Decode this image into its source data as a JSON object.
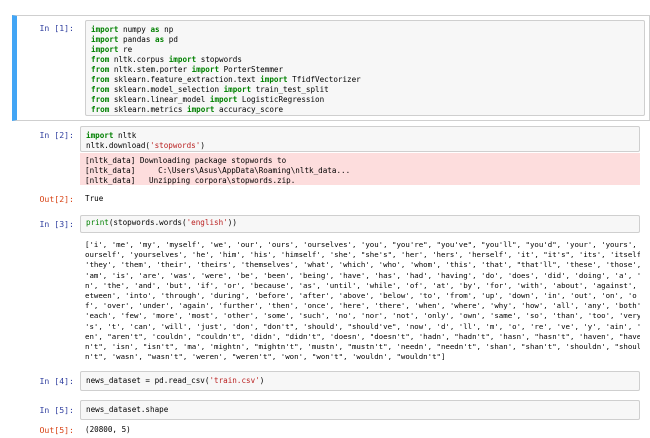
{
  "cells": [
    {
      "prompt": "In [1]:",
      "code": [
        [
          [
            "import",
            "kw"
          ],
          [
            " numpy ",
            ""
          ],
          [
            "as",
            "kw"
          ],
          [
            " np",
            ""
          ]
        ],
        [
          [
            "import",
            "kw"
          ],
          [
            " pandas ",
            ""
          ],
          [
            "as",
            "kw"
          ],
          [
            " pd",
            ""
          ]
        ],
        [
          [
            "import",
            "kw"
          ],
          [
            " re",
            ""
          ]
        ],
        [
          [
            "from",
            "kw"
          ],
          [
            " nltk.corpus ",
            ""
          ],
          [
            "import",
            "kw"
          ],
          [
            " stopwords",
            ""
          ]
        ],
        [
          [
            "from",
            "kw"
          ],
          [
            " nltk.stem.porter ",
            ""
          ],
          [
            "import",
            "kw"
          ],
          [
            " PorterStemmer",
            ""
          ]
        ],
        [
          [
            "from",
            "kw"
          ],
          [
            " sklearn.feature_extraction.text ",
            ""
          ],
          [
            "import",
            "kw"
          ],
          [
            " TfidfVectorizer",
            ""
          ]
        ],
        [
          [
            "from",
            "kw"
          ],
          [
            " sklearn.model_selection ",
            ""
          ],
          [
            "import",
            "kw"
          ],
          [
            " train_test_split",
            ""
          ]
        ],
        [
          [
            "from",
            "kw"
          ],
          [
            " sklearn.linear_model ",
            ""
          ],
          [
            "import",
            "kw"
          ],
          [
            " LogisticRegression",
            ""
          ]
        ],
        [
          [
            "from",
            "kw"
          ],
          [
            " sklearn.metrics ",
            ""
          ],
          [
            "import",
            "kw"
          ],
          [
            " accuracy_score",
            ""
          ]
        ]
      ]
    },
    {
      "prompt": "In [2]:",
      "code": [
        [
          [
            "import",
            "kw"
          ],
          [
            " nltk",
            ""
          ]
        ],
        [
          [
            "nltk.download(",
            ""
          ],
          [
            "'stopwords'",
            "str"
          ],
          [
            ")",
            ""
          ]
        ]
      ],
      "stderr": "[nltk_data] Downloading package stopwords to\n[nltk_data]     C:\\Users\\Asus\\AppData\\Roaming\\nltk_data...\n[nltk_data]   Unzipping corpora\\stopwords.zip.",
      "out_prompt": "Out[2]:",
      "out_text": "True"
    },
    {
      "prompt": "In [3]:",
      "code": [
        [
          [
            "print",
            "bi"
          ],
          [
            "(stopwords.words(",
            ""
          ],
          [
            "'english'",
            "str"
          ],
          [
            "))",
            ""
          ]
        ]
      ],
      "stdout": "['i', 'me', 'my', 'myself', 'we', 'our', 'ours', 'ourselves', 'you', \"you're\", \"you've\", \"you'll\", \"you'd\", 'your', 'yours', 'y\nourself', 'yourselves', 'he', 'him', 'his', 'himself', 'she', \"she's\", 'her', 'hers', 'herself', 'it', \"it's\", 'its', 'itself',\n'they', 'them', 'their', 'theirs', 'themselves', 'what', 'which', 'who', 'whom', 'this', 'that', \"that'll\", 'these', 'those',\n'am', 'is', 'are', 'was', 'were', 'be', 'been', 'being', 'have', 'has', 'had', 'having', 'do', 'does', 'did', 'doing', 'a', 'a\nn', 'the', 'and', 'but', 'if', 'or', 'because', 'as', 'until', 'while', 'of', 'at', 'by', 'for', 'with', 'about', 'against', 'b\netween', 'into', 'through', 'during', 'before', 'after', 'above', 'below', 'to', 'from', 'up', 'down', 'in', 'out', 'on', 'o\nf', 'over', 'under', 'again', 'further', 'then', 'once', 'here', 'there', 'when', 'where', 'why', 'how', 'all', 'any', 'both',\n'each', 'few', 'more', 'most', 'other', 'some', 'such', 'no', 'nor', 'not', 'only', 'own', 'same', 'so', 'than', 'too', 'very',\n's', 't', 'can', 'will', 'just', 'don', \"don't\", 'should', \"should've\", 'now', 'd', 'll', 'm', 'o', 're', 've', 'y', 'ain', 'ar\nen', \"aren't\", 'couldn', \"couldn't\", 'didn', \"didn't\", 'doesn', \"doesn't\", 'hadn', \"hadn't\", 'hasn', \"hasn't\", 'haven', \"have\nn't\", 'isn', \"isn't\", 'ma', 'mightn', \"mightn't\", 'mustn', \"mustn't\", 'needn', \"needn't\", 'shan', \"shan't\", 'shouldn', \"should\nn't\", 'wasn', \"wasn't\", 'weren', \"weren't\", 'won', \"won't\", 'wouldn', \"wouldn't\"]"
    },
    {
      "prompt": "In [4]:",
      "code": [
        [
          [
            "news_dataset = pd.read_csv(",
            ""
          ],
          [
            "'train.csv'",
            "str"
          ],
          [
            ")",
            ""
          ]
        ]
      ]
    },
    {
      "prompt": "In [5]:",
      "code": [
        [
          [
            "news_dataset.shape",
            ""
          ]
        ]
      ],
      "out_prompt": "Out[5]:",
      "out_text": "(20800, 5)"
    }
  ]
}
